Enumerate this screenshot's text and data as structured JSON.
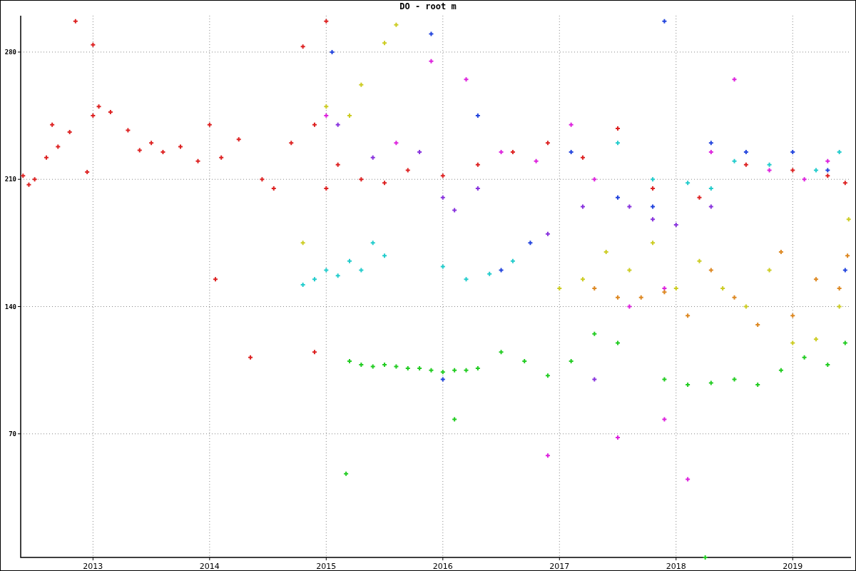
{
  "chart_data": {
    "type": "scatter",
    "title": "DO - root m",
    "grid": true,
    "xlim": [
      2012.38,
      2019.5
    ],
    "ylim": [
      2,
      300
    ],
    "xticks": [
      {
        "value": 2013,
        "label": "2013"
      },
      {
        "value": 2014,
        "label": "2014"
      },
      {
        "value": 2015,
        "label": "2015"
      },
      {
        "value": 2016,
        "label": "2016"
      },
      {
        "value": 2017,
        "label": "2017"
      },
      {
        "value": 2018,
        "label": "2018"
      },
      {
        "value": 2019,
        "label": "2019"
      }
    ],
    "yticks": [
      70,
      140,
      210,
      280
    ],
    "series": [
      {
        "color": "#dd2222",
        "x": [
          2012.4,
          2012.45,
          2012.5,
          2012.6,
          2012.65,
          2012.7,
          2012.8,
          2012.85,
          2012.95,
          2013.0,
          2013.05,
          2013.15,
          2013.3,
          2013.4,
          2013.5,
          2013.6,
          2013.75,
          2013.9,
          2014.0,
          2014.1,
          2014.25,
          2014.45,
          2014.55,
          2014.7,
          2014.8,
          2014.9,
          2015.0,
          2015.1,
          2015.3,
          2015.5,
          2015.7,
          2016.0,
          2016.3,
          2016.6,
          2016.9,
          2017.2,
          2017.5,
          2017.8,
          2018.2,
          2018.6,
          2019.0,
          2019.3,
          2019.45,
          2014.05,
          2014.35,
          2014.9,
          2015.0,
          2013.0
        ],
        "values": [
          212,
          207,
          210,
          222,
          240,
          228,
          236,
          297,
          214,
          245,
          250,
          247,
          237,
          226,
          230,
          225,
          228,
          220,
          240,
          222,
          232,
          210,
          205,
          230,
          283,
          240,
          205,
          218,
          210,
          208,
          215,
          212,
          218,
          225,
          230,
          222,
          238,
          205,
          200,
          218,
          215,
          212,
          208,
          155,
          112,
          115,
          297,
          284
        ]
      },
      {
        "color": "#22cc22",
        "x": [
          2015.2,
          2015.3,
          2015.4,
          2015.5,
          2015.6,
          2015.7,
          2015.8,
          2015.9,
          2016.0,
          2016.1,
          2016.2,
          2016.3,
          2016.5,
          2016.7,
          2016.9,
          2017.1,
          2017.3,
          2017.5,
          2017.9,
          2018.1,
          2018.3,
          2018.5,
          2018.7,
          2018.9,
          2019.1,
          2019.3,
          2015.17,
          2016.1,
          2018.25,
          2019.45
        ],
        "values": [
          110,
          108,
          107,
          108,
          107,
          106,
          106,
          105,
          104,
          105,
          105,
          106,
          115,
          110,
          102,
          110,
          125,
          120,
          100,
          97,
          98,
          100,
          97,
          105,
          112,
          108,
          48,
          78,
          2,
          120
        ]
      },
      {
        "color": "#22cccc",
        "x": [
          2014.8,
          2014.9,
          2015.0,
          2015.1,
          2015.2,
          2015.3,
          2015.4,
          2015.5,
          2016.0,
          2016.2,
          2016.4,
          2016.6,
          2017.5,
          2017.8,
          2018.1,
          2018.3,
          2018.5,
          2018.8,
          2019.2,
          2019.4
        ],
        "values": [
          152,
          155,
          160,
          157,
          165,
          160,
          175,
          168,
          162,
          155,
          158,
          165,
          230,
          210,
          208,
          205,
          220,
          218,
          215,
          225
        ]
      },
      {
        "color": "#cccc22",
        "x": [
          2015.0,
          2015.2,
          2015.3,
          2015.5,
          2015.6,
          2017.0,
          2017.2,
          2017.4,
          2017.6,
          2017.8,
          2018.0,
          2018.2,
          2018.4,
          2018.6,
          2018.8,
          2019.0,
          2019.2,
          2019.4,
          2019.48,
          2014.8
        ],
        "values": [
          250,
          245,
          262,
          285,
          295,
          150,
          155,
          170,
          160,
          175,
          150,
          165,
          150,
          140,
          160,
          120,
          122,
          140,
          188,
          175
        ]
      },
      {
        "color": "#dd22dd",
        "x": [
          2015.0,
          2015.6,
          2015.9,
          2016.2,
          2016.5,
          2016.8,
          2016.9,
          2017.1,
          2017.3,
          2017.6,
          2017.9,
          2018.1,
          2018.3,
          2018.5,
          2018.8,
          2019.1,
          2019.3,
          2017.5,
          2017.9
        ],
        "values": [
          245,
          230,
          275,
          265,
          225,
          220,
          58,
          240,
          210,
          140,
          150,
          45,
          225,
          265,
          215,
          210,
          220,
          68,
          78
        ]
      },
      {
        "color": "#2244dd",
        "x": [
          2015.05,
          2015.9,
          2016.0,
          2016.3,
          2016.5,
          2016.75,
          2017.1,
          2017.5,
          2017.8,
          2017.9,
          2018.3,
          2018.6,
          2019.0,
          2019.3,
          2019.45
        ],
        "values": [
          280,
          290,
          100,
          245,
          160,
          175,
          225,
          200,
          195,
          297,
          230,
          225,
          225,
          215,
          160
        ]
      },
      {
        "color": "#dd8822",
        "x": [
          2017.3,
          2017.5,
          2017.7,
          2017.9,
          2018.1,
          2018.3,
          2018.5,
          2018.7,
          2018.9,
          2019.0,
          2019.2,
          2019.4,
          2019.47
        ],
        "values": [
          150,
          145,
          145,
          148,
          135,
          160,
          145,
          130,
          170,
          135,
          155,
          150,
          168
        ]
      },
      {
        "color": "#8833dd",
        "x": [
          2015.1,
          2015.4,
          2015.8,
          2016.0,
          2016.1,
          2016.3,
          2016.9,
          2017.2,
          2017.6,
          2017.8,
          2018.0,
          2018.3,
          2017.3
        ],
        "values": [
          240,
          222,
          225,
          200,
          193,
          205,
          180,
          195,
          195,
          188,
          185,
          195,
          100
        ]
      }
    ]
  }
}
